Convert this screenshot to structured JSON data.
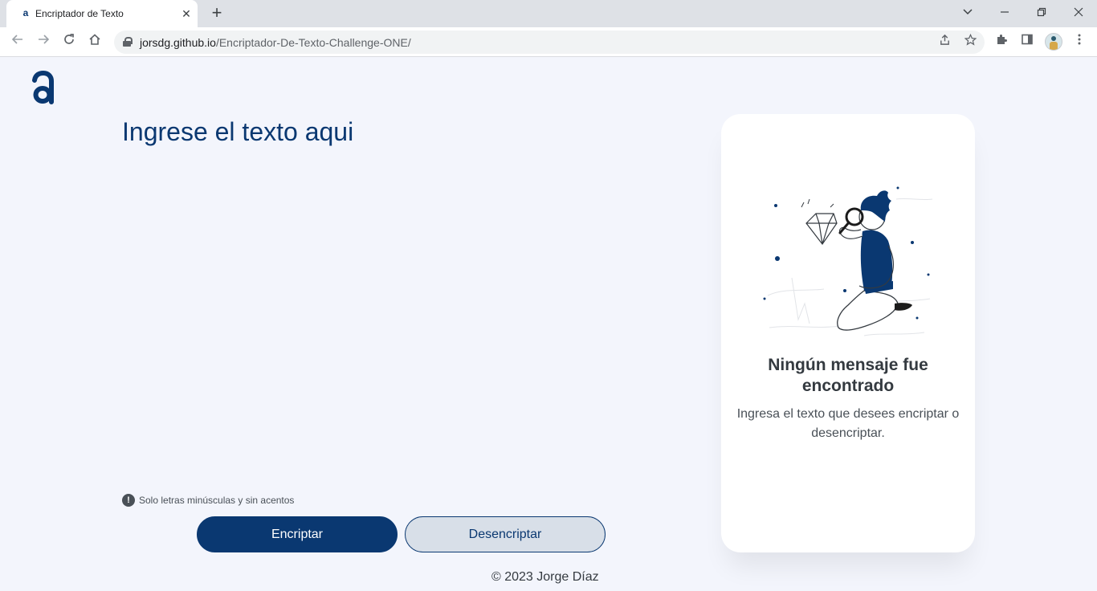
{
  "browser": {
    "tab_title": "Encriptador de Texto",
    "tab_favicon": "a",
    "url_host": "jorsdg.github.io",
    "url_path": "/Encriptador-De-Texto-Challenge-ONE/"
  },
  "page": {
    "title": "Ingrese el texto aqui",
    "input_value": "",
    "hint": "Solo letras minúsculas y sin acentos",
    "encrypt_label": "Encriptar",
    "decrypt_label": "Desencriptar",
    "footer": "© 2023 Jorge Díaz"
  },
  "result_card": {
    "title": "Ningún mensaje fue encontrado",
    "message": "Ingresa el texto que desees encriptar o desencriptar."
  },
  "colors": {
    "primary": "#0a3871",
    "background": "#f3f5fc",
    "card": "#ffffff"
  }
}
